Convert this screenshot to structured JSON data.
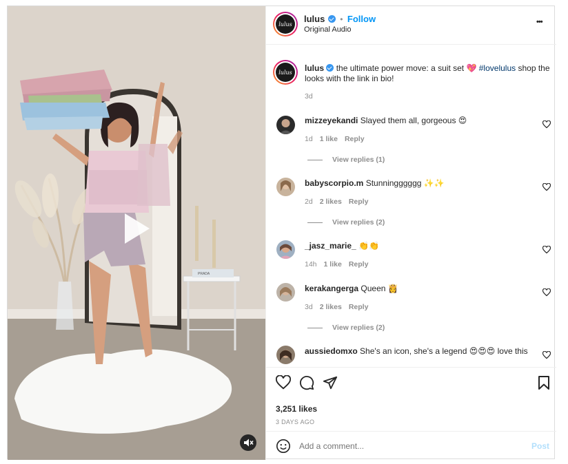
{
  "header": {
    "username": "lulus",
    "follow_label": "Follow",
    "audio_label": "Original Audio",
    "more_label": "•••",
    "avatar_text": "lulus"
  },
  "caption": {
    "username": "lulus",
    "text": "the ultimate power move: a suit set 💖",
    "hashtag": "#lovelulus",
    "text_after": "shop the looks with the link in bio!",
    "time": "3d"
  },
  "comments": [
    {
      "username": "mizzeyekandi",
      "text": "Slayed them all, gorgeous 😍",
      "time": "1d",
      "likes": "1 like",
      "reply": "Reply",
      "view_replies": "View replies (1)"
    },
    {
      "username": "babyscorpio.m",
      "text": "Stunningggggg ✨✨",
      "time": "2d",
      "likes": "2 likes",
      "reply": "Reply",
      "view_replies": "View replies (2)"
    },
    {
      "username": "_jasz_marie_",
      "text": "👏👏",
      "time": "14h",
      "likes": "1 like",
      "reply": "Reply"
    },
    {
      "username": "kerakangerga",
      "text": "Queen 👸",
      "time": "3d",
      "likes": "2 likes",
      "reply": "Reply",
      "view_replies": "View replies (2)"
    },
    {
      "username": "aussiedomxo",
      "text": "She's an icon, she's a legend 😍😍😍 love this"
    }
  ],
  "stats": {
    "likes": "3,251 likes",
    "date": "3 DAYS AGO"
  },
  "add_comment": {
    "placeholder": "Add a comment...",
    "post_label": "Post"
  },
  "media": {
    "box_label": "PRADA"
  },
  "colors": {
    "accent": "#0095f6",
    "text": "#262626",
    "muted": "#8e8e8e",
    "border": "#dbdbdb"
  },
  "icons": [
    "play-icon",
    "mute-icon",
    "heart-icon",
    "comment-icon",
    "share-icon",
    "bookmark-icon",
    "emoji-icon",
    "more-icon",
    "verified-icon"
  ]
}
